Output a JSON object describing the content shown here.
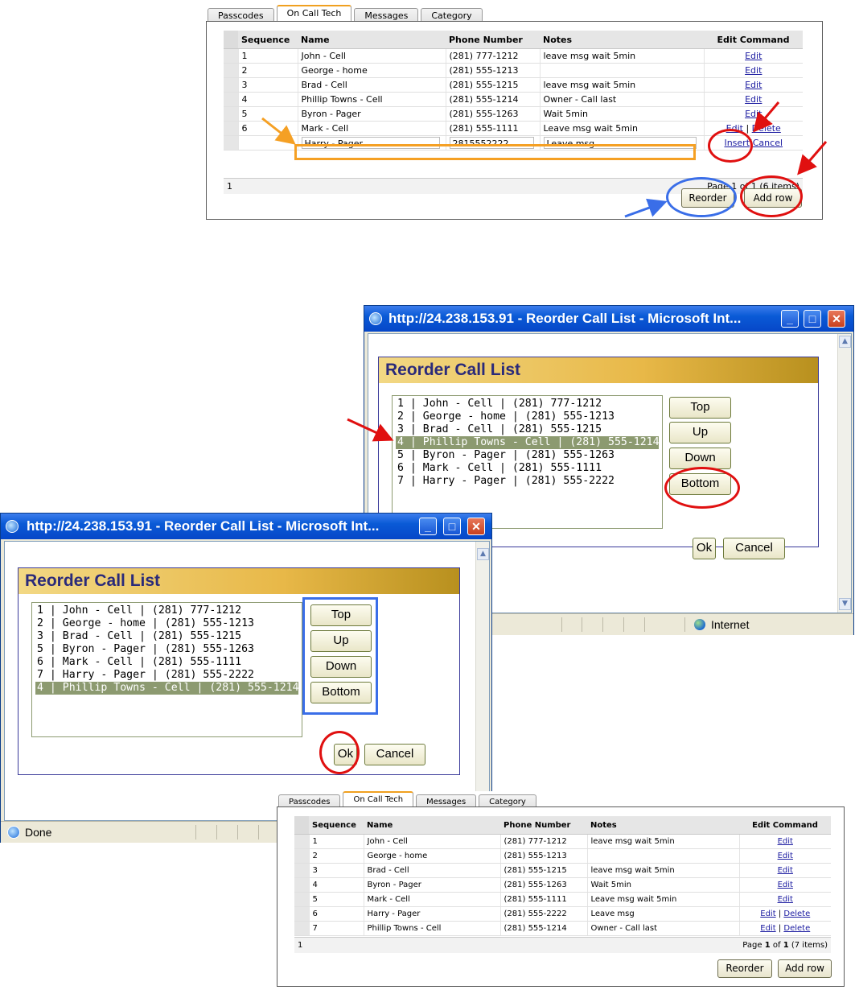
{
  "tabs": [
    "Passcodes",
    "On Call Tech",
    "Messages",
    "Category"
  ],
  "grid_headers": {
    "sequence": "Sequence",
    "name": "Name",
    "phone": "Phone Number",
    "notes": "Notes",
    "edit": "Edit Command"
  },
  "top_grid": {
    "rows": [
      {
        "seq": "1",
        "name": "John - Cell",
        "phone": "(281) 777-1212",
        "notes": "leave msg wait 5min",
        "cmd": "Edit"
      },
      {
        "seq": "2",
        "name": "George - home",
        "phone": "(281) 555-1213",
        "notes": "",
        "cmd": "Edit"
      },
      {
        "seq": "3",
        "name": "Brad - Cell",
        "phone": "(281) 555-1215",
        "notes": "leave msg wait 5min",
        "cmd": "Edit"
      },
      {
        "seq": "4",
        "name": "Phillip Towns - Cell",
        "phone": "(281) 555-1214",
        "notes": "Owner - Call last",
        "cmd": "Edit"
      },
      {
        "seq": "5",
        "name": "Byron - Pager",
        "phone": "(281) 555-1263",
        "notes": "Wait 5min",
        "cmd": "Edit"
      },
      {
        "seq": "6",
        "name": "Mark - Cell",
        "phone": "(281) 555-1111",
        "notes": "Leave msg wait 5min",
        "cmd": "Edit",
        "cmd2": "Delete"
      }
    ],
    "insert_row": {
      "name": "Harry - Pager",
      "phone": "2815552222",
      "notes": "Leave msg",
      "insert": "Insert",
      "cancel": "Cancel"
    },
    "pager_left": "1",
    "pager_right": "Page 1 of 1 (6 items)",
    "sep": "|"
  },
  "bottom_grid": {
    "rows": [
      {
        "seq": "1",
        "name": "John - Cell",
        "phone": "(281) 777-1212",
        "notes": "leave msg wait 5min",
        "cmd": "Edit"
      },
      {
        "seq": "2",
        "name": "George - home",
        "phone": "(281) 555-1213",
        "notes": "",
        "cmd": "Edit"
      },
      {
        "seq": "3",
        "name": "Brad - Cell",
        "phone": "(281) 555-1215",
        "notes": "leave msg wait 5min",
        "cmd": "Edit"
      },
      {
        "seq": "4",
        "name": "Byron - Pager",
        "phone": "(281) 555-1263",
        "notes": "Wait 5min",
        "cmd": "Edit"
      },
      {
        "seq": "5",
        "name": "Mark - Cell",
        "phone": "(281) 555-1111",
        "notes": "Leave msg wait 5min",
        "cmd": "Edit"
      },
      {
        "seq": "6",
        "name": "Harry - Pager",
        "phone": "(281) 555-2222",
        "notes": "Leave msg",
        "cmd": "Edit",
        "cmd2": "Delete"
      },
      {
        "seq": "7",
        "name": "Phillip Towns - Cell",
        "phone": "(281) 555-1214",
        "notes": "Owner - Call last",
        "cmd": "Edit",
        "cmd2": "Delete"
      }
    ],
    "pager_left": "1",
    "pager_page_label": "Page",
    "pager_page": "1",
    "pager_of": "of",
    "pager_total": "1",
    "pager_items": "(7 items)"
  },
  "buttons": {
    "reorder": "Reorder",
    "add_row": "Add row"
  },
  "window_title": "http://24.238.153.91 - Reorder Call List - Microsoft Int...",
  "dialog_title": "Reorder Call List",
  "dialog_buttons": {
    "top": "Top",
    "up": "Up",
    "down": "Down",
    "bottom": "Bottom",
    "ok": "Ok",
    "cancel": "Cancel"
  },
  "list_before": [
    "1 | John - Cell | (281) 777-1212",
    "2 | George - home | (281) 555-1213",
    "3 | Brad - Cell | (281) 555-1215",
    "4 | Phillip Towns - Cell | (281) 555-1214",
    "5 | Byron - Pager | (281) 555-1263",
    "6 | Mark - Cell | (281) 555-1111",
    "7 | Harry - Pager | (281) 555-2222"
  ],
  "list_before_selected": 3,
  "list_after": [
    "1 | John - Cell | (281) 777-1212",
    "2 | George - home | (281) 555-1213",
    "3 | Brad - Cell | (281) 555-1215",
    "5 | Byron - Pager | (281) 555-1263",
    "6 | Mark - Cell | (281) 555-1111",
    "7 | Harry - Pager | (281) 555-2222",
    "4 | Phillip Towns - Cell | (281) 555-1214"
  ],
  "list_after_selected": 6,
  "status": {
    "done": "Done",
    "zone": "Internet"
  },
  "colors": {
    "orange": "#f5a024",
    "red": "#e01010",
    "blue": "#3a6ee8"
  }
}
